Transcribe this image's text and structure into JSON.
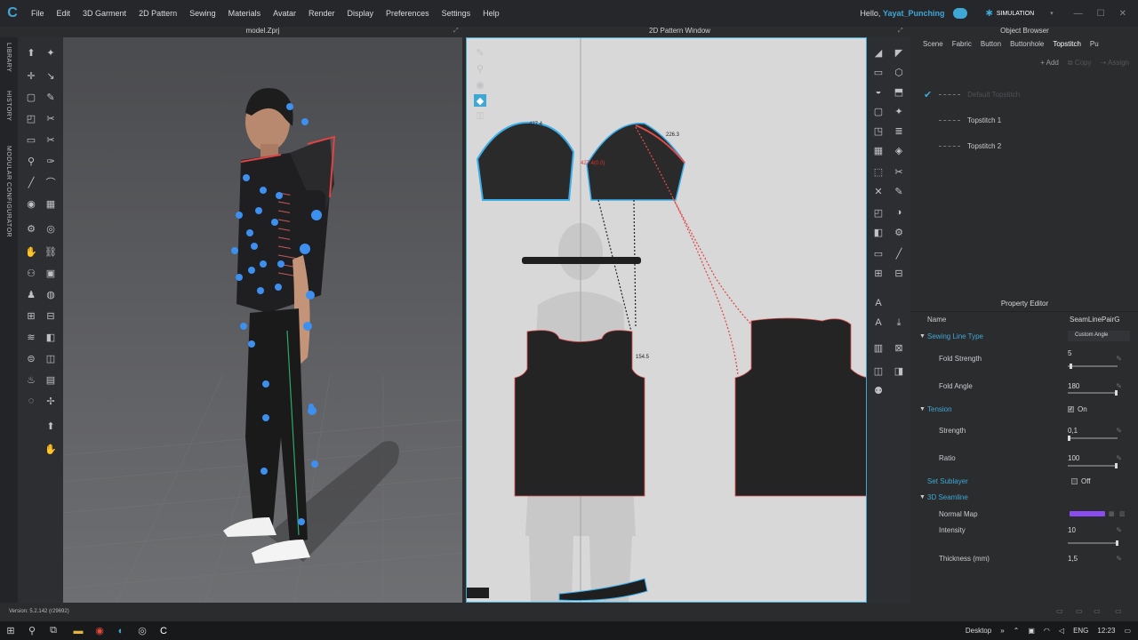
{
  "menubar": {
    "items": [
      "File",
      "Edit",
      "3D Garment",
      "2D Pattern",
      "Sewing",
      "Materials",
      "Avatar",
      "Render",
      "Display",
      "Preferences",
      "Settings",
      "Help"
    ],
    "greeting": "Hello,",
    "username": "Yayat_Punching",
    "simulation": "SIMULATION"
  },
  "left_strip": {
    "library": "LIBRARY",
    "history": "HISTORY",
    "modular": "MODULAR CONFIGURATOR"
  },
  "viewport": {
    "title": "model.Zprj"
  },
  "pattern_window": {
    "title": "2D Pattern Window",
    "measure_1": "427.4",
    "measure_2": "226.3",
    "measure_3": "154.5",
    "measure_red": "427.4(0.0)"
  },
  "object_browser": {
    "title": "Object Browser",
    "tabs": [
      "Scene",
      "Fabric",
      "Button",
      "Buttonhole",
      "Topstitch",
      "Pu"
    ],
    "active_tab": "Topstitch",
    "add_label": "Add",
    "copy_label": "Copy",
    "assign_label": "Assign",
    "items": [
      "Default Topstitch",
      "Topstitch 1",
      "Topstitch 2"
    ]
  },
  "property_editor": {
    "title": "Property Editor",
    "name_label": "Name",
    "name_value": "SeamLinePairG",
    "sewing_line_type": "Sewing Line Type",
    "sewing_line_type_value": "Custom Angle",
    "fold_strength": "Fold Strength",
    "fold_strength_value": "5",
    "fold_angle": "Fold Angle",
    "fold_angle_value": "180",
    "tension": "Tension",
    "tension_value": "On",
    "strength": "Strength",
    "strength_value": "0,1",
    "ratio": "Ratio",
    "ratio_value": "100",
    "set_sublayer": "Set Sublayer",
    "set_sublayer_value": "Off",
    "seamline_3d": "3D Seamline",
    "normal_map": "Normal Map",
    "intensity": "Intensity",
    "intensity_value": "10",
    "thickness": "Thickness (mm)",
    "thickness_value": "1,5",
    "accent_color": "#3fa7d6",
    "normal_map_color": "#8a4cf0"
  },
  "statusbar": {
    "version": "Version: 5.2.142 (r29692)"
  },
  "taskbar": {
    "desktop": "Desktop",
    "lang": "ENG",
    "time": "12:23"
  }
}
